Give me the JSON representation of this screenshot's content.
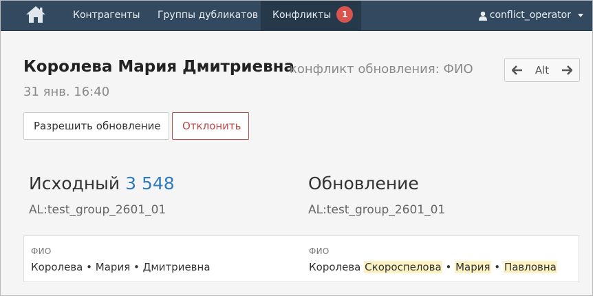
{
  "navbar": {
    "home_icon": "home-icon",
    "items": [
      {
        "label": "Контрагенты"
      },
      {
        "label": "Группы дубликатов"
      },
      {
        "label": "Конфликты",
        "badge": "1"
      }
    ],
    "user": {
      "name": "conflict_operator",
      "icon": "user-icon"
    }
  },
  "header": {
    "title": "Королева Мария Дмитриевна",
    "subtitle": "конфликт обновления: ФИО",
    "datetime": "31 янв. 16:40",
    "pager_label": "Alt"
  },
  "actions": {
    "resolve_label": "Разрешить обновление",
    "reject_label": "Отклонить"
  },
  "original": {
    "heading": "Исходный",
    "id_link": "3 548",
    "group": "AL:test_group_2601_01",
    "field_label": "ФИО",
    "parts": [
      "Королева",
      "Мария",
      "Дмитриевна"
    ]
  },
  "update": {
    "heading": "Обновление",
    "group": "AL:test_group_2601_01",
    "field_label": "ФИО",
    "part_plain": "Королева",
    "part_hl1": "Скороспелова",
    "part_hl2": "Мария",
    "part_hl3": "Павловна"
  },
  "separator": "•",
  "colors": {
    "navbar": "#33495f",
    "badge": "#d9534f",
    "link": "#2f7bbf",
    "reject": "#b94a48",
    "highlight": "#fcf3c4"
  }
}
